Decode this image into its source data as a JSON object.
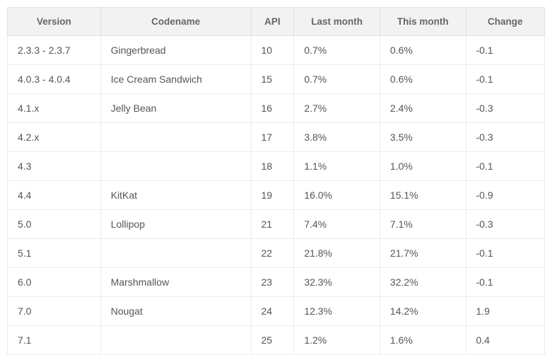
{
  "table": {
    "headers": {
      "version": "Version",
      "codename": "Codename",
      "api": "API",
      "last_month": "Last month",
      "this_month": "This month",
      "change": "Change"
    },
    "rows": [
      {
        "version": "2.3.3 - 2.3.7",
        "codename": "Gingerbread",
        "api": "10",
        "last_month": "0.7%",
        "this_month": "0.6%",
        "change": "-0.1"
      },
      {
        "version": "4.0.3 - 4.0.4",
        "codename": "Ice Cream Sandwich",
        "api": "15",
        "last_month": "0.7%",
        "this_month": "0.6%",
        "change": "-0.1"
      },
      {
        "version": "4.1.x",
        "codename": "Jelly Bean",
        "api": "16",
        "last_month": "2.7%",
        "this_month": "2.4%",
        "change": "-0.3"
      },
      {
        "version": "4.2.x",
        "codename": "",
        "api": "17",
        "last_month": "3.8%",
        "this_month": "3.5%",
        "change": "-0.3"
      },
      {
        "version": "4.3",
        "codename": "",
        "api": "18",
        "last_month": "1.1%",
        "this_month": "1.0%",
        "change": "-0.1"
      },
      {
        "version": "4.4",
        "codename": "KitKat",
        "api": "19",
        "last_month": "16.0%",
        "this_month": "15.1%",
        "change": "-0.9"
      },
      {
        "version": "5.0",
        "codename": "Lollipop",
        "api": "21",
        "last_month": "7.4%",
        "this_month": "7.1%",
        "change": "-0.3"
      },
      {
        "version": "5.1",
        "codename": "",
        "api": "22",
        "last_month": "21.8%",
        "this_month": "21.7%",
        "change": "-0.1"
      },
      {
        "version": "6.0",
        "codename": "Marshmallow",
        "api": "23",
        "last_month": "32.3%",
        "this_month": "32.2%",
        "change": "-0.1"
      },
      {
        "version": "7.0",
        "codename": "Nougat",
        "api": "24",
        "last_month": "12.3%",
        "this_month": "14.2%",
        "change": "1.9"
      },
      {
        "version": "7.1",
        "codename": "",
        "api": "25",
        "last_month": "1.2%",
        "this_month": "1.6%",
        "change": "0.4"
      }
    ]
  }
}
